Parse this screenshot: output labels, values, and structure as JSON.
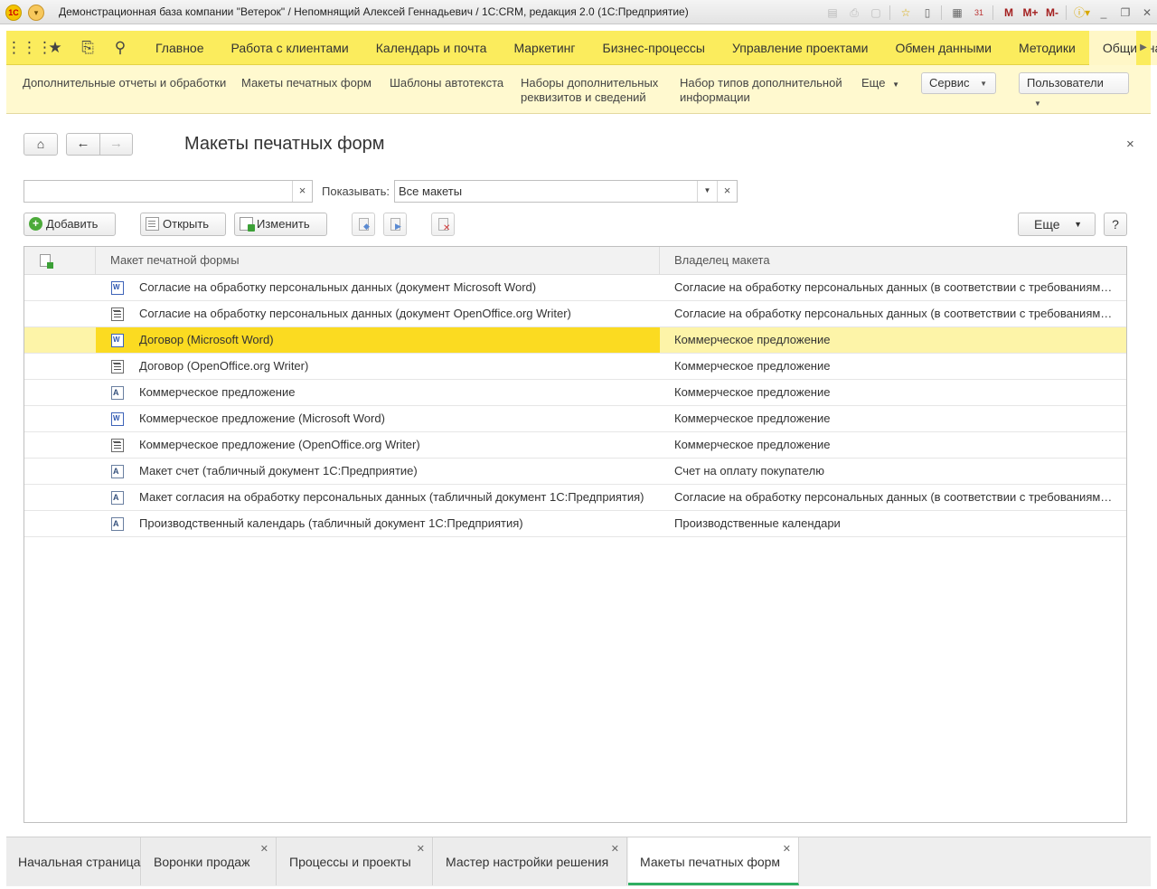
{
  "window": {
    "title": "Демонстрационная база компании \"Ветерок\" / Непомнящий Алексей Геннадьевич / 1С:CRM, редакция 2.0  (1С:Предприятие)",
    "logo": "1С",
    "toolbar_icons": [
      "save-icon",
      "print-icon",
      "preview-icon",
      "favorites-icon",
      "history-icon",
      "calculator-icon",
      "calendar-icon",
      "memory-m-icon",
      "memory-plus-icon",
      "memory-minus-icon",
      "info-icon",
      "minimize-icon",
      "restore-icon",
      "close-icon"
    ],
    "memory_labels": [
      "M",
      "M+",
      "M-"
    ],
    "calendar_day": "31"
  },
  "sections": {
    "quick_icons": [
      "apps-grid-icon",
      "favorites-star-icon",
      "history-icon",
      "search-icon"
    ],
    "items": [
      {
        "label": "Главное"
      },
      {
        "label": "Работа с клиентами"
      },
      {
        "label": "Календарь и почта"
      },
      {
        "label": "Маркетинг"
      },
      {
        "label": "Бизнес-процессы"
      },
      {
        "label": "Управление проектами"
      },
      {
        "label": "Обмен данными"
      },
      {
        "label": "Методики"
      },
      {
        "label": "Общие настро"
      }
    ]
  },
  "actions": {
    "items": [
      {
        "label": "Дополнительные отчеты и обработки"
      },
      {
        "label": "Макеты печатных форм"
      },
      {
        "label": "Шаблоны автотекста"
      },
      {
        "label_line1": "Наборы дополнительных",
        "label_line2": "реквизитов и сведений"
      },
      {
        "label_line1": "Набор типов дополнительной",
        "label_line2": "информации"
      }
    ],
    "more_label": "Еще",
    "service_label": "Сервис",
    "users_label": "Пользователи"
  },
  "form": {
    "title": "Макеты печатных форм",
    "search": {
      "value": "",
      "placeholder": ""
    },
    "show_label": "Показывать:",
    "show_value": "Все макеты",
    "buttons": {
      "add": "Добавить",
      "open": "Открыть",
      "edit": "Изменить",
      "more": "Еще",
      "help": "?"
    }
  },
  "table": {
    "columns": [
      "Макет печатной формы",
      "Владелец макета"
    ],
    "rows": [
      {
        "icon": "word",
        "name": "Согласие на обработку персональных данных (документ Microsoft Word)",
        "owner": "Согласие на обработку персональных данных (в соответствии с требованиями..."
      },
      {
        "icon": "odt",
        "name": "Согласие на обработку персональных данных (документ OpenOffice.org Writer)",
        "owner": "Согласие на обработку персональных данных (в соответствии с требованиями..."
      },
      {
        "icon": "word",
        "name": "Договор (Microsoft Word)",
        "owner": "Коммерческое предложение",
        "selected": true
      },
      {
        "icon": "odt",
        "name": "Договор (OpenOffice.org Writer)",
        "owner": "Коммерческое предложение"
      },
      {
        "icon": "mxl",
        "name": "Коммерческое предложение",
        "owner": "Коммерческое предложение"
      },
      {
        "icon": "word",
        "name": "Коммерческое предложение (Microsoft Word)",
        "owner": "Коммерческое предложение"
      },
      {
        "icon": "odt",
        "name": "Коммерческое предложение (OpenOffice.org Writer)",
        "owner": "Коммерческое предложение"
      },
      {
        "icon": "mxl",
        "name": "Макет счет (табличный документ 1С:Предприятие)",
        "owner": "Счет на оплату покупателю"
      },
      {
        "icon": "mxl",
        "name": "Макет согласия на обработку персональных данных (табличный документ 1С:Предприятия)",
        "owner": "Согласие на обработку персональных данных (в соответствии с требованиями..."
      },
      {
        "icon": "mxl",
        "name": "Производственный календарь (табличный документ 1С:Предприятия)",
        "owner": "Производственные календари"
      }
    ]
  },
  "open_windows": [
    {
      "label": "Начальная страница",
      "closable": false
    },
    {
      "label": "Воронки продаж",
      "closable": true
    },
    {
      "label": "Процессы и проекты",
      "closable": true
    },
    {
      "label": "Мастер настройки решения",
      "closable": true
    },
    {
      "label": "Макеты печатных форм",
      "closable": true,
      "active": true
    }
  ],
  "colors": {
    "section_bar": "#fbec5d",
    "action_panel": "#fff9cf",
    "selected_row": "#fbdb21",
    "active_tab_underline": "#2fae61"
  }
}
